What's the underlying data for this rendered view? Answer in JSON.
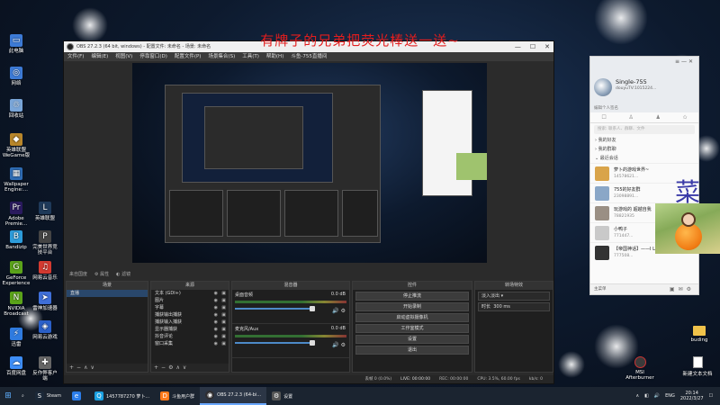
{
  "overlay": {
    "text": "有牌子的兄弟把荧光棒送一送~"
  },
  "desktop": {
    "left_icons": [
      {
        "label": "此电脑",
        "icon": "computer-icon",
        "color": "#3d7bd6"
      },
      {
        "label": "网络",
        "icon": "network-icon",
        "color": "#3d7bd6"
      },
      {
        "label": "回收站",
        "icon": "recycle-bin-icon",
        "color": "#7aa6d9"
      },
      {
        "label": "英雄联盟WeGame版",
        "icon": "game-icon",
        "color": "#b8862b"
      },
      {
        "label": "Wallpaper Engine:...",
        "icon": "wallpaper-icon",
        "color": "#2f6db5"
      },
      {
        "label": "Adobe Premie...",
        "icon": "premiere-icon",
        "color": "#2a1a5e"
      },
      {
        "label": "Bandizip",
        "icon": "bandizip-icon",
        "color": "#2d9cdb"
      },
      {
        "label": "GeForce Experience",
        "icon": "geforce-icon",
        "color": "#5ba31a"
      },
      {
        "label": "NVIDIA Broadcast",
        "icon": "nvidia-icon",
        "color": "#5ba31a"
      },
      {
        "label": "迅雷",
        "icon": "thunder-icon",
        "color": "#2f7be0"
      },
      {
        "label": "百度网盘",
        "icon": "baidu-netdisk-icon",
        "color": "#3e8ef7"
      }
    ],
    "second_col_icons": [
      {
        "label": "英雄联盟",
        "icon": "lol-icon",
        "color": "#1f3a5a"
      },
      {
        "label": "完美世界竞技平台",
        "icon": "perfect-icon",
        "color": "#444"
      },
      {
        "label": "网易云音乐",
        "icon": "music-icon",
        "color": "#d33a31"
      },
      {
        "label": "雷神加速器",
        "icon": "accelerator-icon",
        "color": "#3f6fd8"
      },
      {
        "label": "网易云游戏",
        "icon": "cloud-game-icon",
        "color": "#2b60c9"
      },
      {
        "label": "反作弊客户端",
        "icon": "anticheat-icon",
        "color": "#666"
      }
    ],
    "right_icons": [
      {
        "label": "buding",
        "icon": "folder-icon"
      },
      {
        "label": "新建文本文档",
        "icon": "text-file-icon"
      },
      {
        "label": "MSI Afterburner",
        "icon": "afterburner-icon"
      }
    ]
  },
  "obs": {
    "title": "OBS 27.2.3 (64 bit, windows) - 配置文件: 未命名 - 场景: 未命名",
    "menu": [
      "文件(F)",
      "编辑(E)",
      "视图(V)",
      "停靠窗口(D)",
      "配置文件(P)",
      "场景集合(S)",
      "工具(T)",
      "帮助(H)",
      "斗鱼-755直播间"
    ],
    "toolbar_label": "来自国度",
    "toolbar_items": [
      "属性",
      "滤镜"
    ],
    "scenes": {
      "header": "场景",
      "items": [
        "直播"
      ]
    },
    "sources": {
      "header": "来源",
      "items": [
        "文本 (GDI+)",
        "图片",
        "字幕",
        "捕获输出捕获",
        "捕获输入捕获",
        "显示器捕获",
        "抖音评论",
        "窗口采集"
      ]
    },
    "mixer": {
      "header": "混音器",
      "channels": [
        {
          "name": "桌面音频",
          "db": "0.0 dB"
        },
        {
          "name": "麦克风/Aux",
          "db": "0.0 dB"
        }
      ]
    },
    "controls": {
      "header": "控件",
      "buttons": [
        "停止推流",
        "开始录制",
        "启动虚拟摄像机",
        "工作室模式",
        "设置",
        "退出"
      ]
    },
    "transitions": {
      "header": "转场特效",
      "type": "淡入淡出",
      "duration_label": "时长",
      "duration_value": "300 ms"
    },
    "status": {
      "dropped": "丢帧 0 (0.0%)",
      "live": "LIVE: 00:00:00",
      "rec": "REC: 00:00:00",
      "cpu": "CPU: 3.5%, 60.00 fps",
      "kbps": "kb/s: 0"
    }
  },
  "chat": {
    "username": "Single-755",
    "user_id": "douyuTV:1015224...",
    "signature": "编辑个人签名",
    "search_placeholder": "搜索: 联系人、群聊、文件",
    "groups": [
      "我的好友",
      "我的群聊",
      "最近会话"
    ],
    "contacts": [
      {
        "name": "萝卜的游戏世界~",
        "meta": "14578621..."
      },
      {
        "name": "755的好友群",
        "meta": "23098891..."
      },
      {
        "name": "玩游戏的 超越自我",
        "meta": "78821935"
      },
      {
        "name": "小鸭子",
        "meta": "771447..."
      },
      {
        "name": "【帝国神话】——I Lov...",
        "meta": "777508..."
      }
    ],
    "footer_text": "主菜单"
  },
  "cai_char": "菜",
  "taskbar": {
    "items": [
      {
        "label": "Steam",
        "icon": "steam-icon",
        "color": "#1b2838"
      },
      {
        "label": "",
        "icon": "browser-icon",
        "color": "#2b7de9"
      },
      {
        "label": "1457787270 萝卜...",
        "icon": "qq-icon",
        "color": "#1ba1e2"
      },
      {
        "label": "斗鱼用户群",
        "icon": "douyu-icon",
        "color": "#ff7a1a"
      },
      {
        "label": "OBS 27.2.3 (64-bi...",
        "icon": "obs-icon",
        "color": "#302e31"
      },
      {
        "label": "设置",
        "icon": "settings-icon",
        "color": "#555"
      }
    ],
    "lang": "ENG",
    "time": "20:14",
    "date": "2022/3/27"
  }
}
